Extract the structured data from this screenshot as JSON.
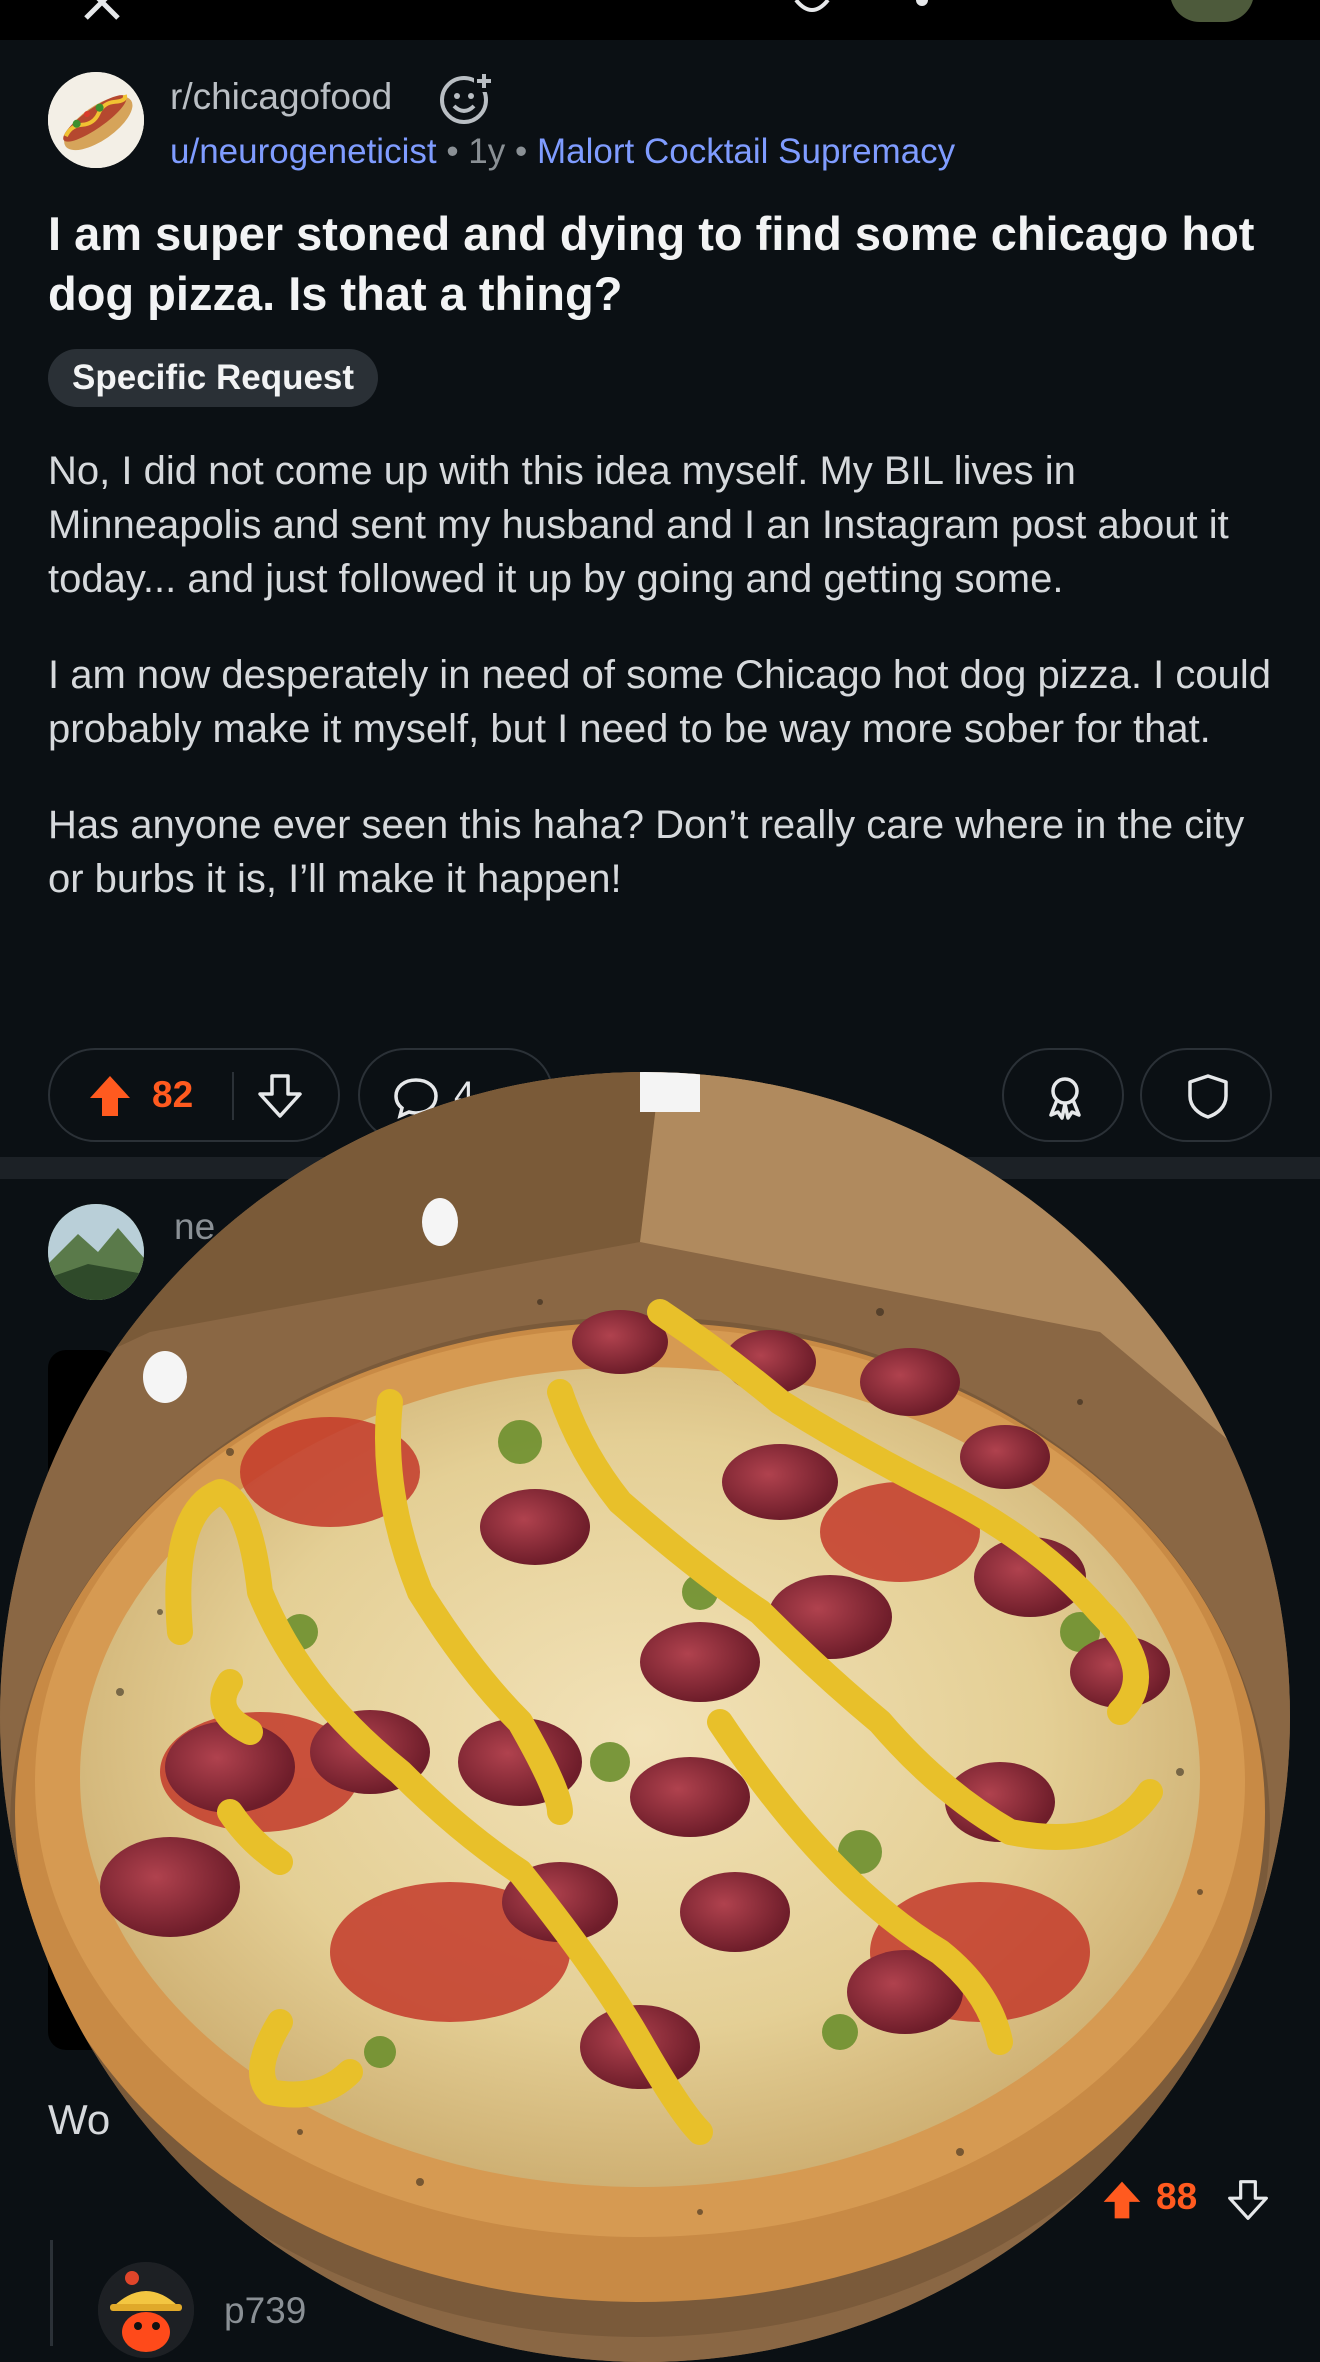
{
  "topbar": {
    "icons": [
      "close-icon",
      "shield-icon",
      "search-icon",
      "user-avatar"
    ]
  },
  "post": {
    "subreddit": "r/chicagofood",
    "author": "u/neurogeneticist",
    "age": "1y",
    "user_flair": "Malort Cocktail Supremacy",
    "title": "I am super stoned and dying to find some chicago hot dog pizza. Is that a thing?",
    "post_flair": "Specific Request",
    "body": [
      "No, I did not come up with this idea myself. My BIL lives in Minneapolis and sent my husband and I an Instagram post about it today... and just followed it up by going and getting some.",
      "I am now desperately in need of some Chicago hot dog pizza. I could probably make it myself, but I need to be way more sober for that.",
      "Has anyone ever seen this haha? Don’t really care where in the city or burbs it is, I’ll make it happen!"
    ],
    "score": "82",
    "comments_count_partial": "4",
    "icons": [
      "upvote-icon",
      "downvote-icon",
      "comment-icon",
      "award-icon",
      "mod-shield-icon"
    ]
  },
  "comment": {
    "author_partial": "ne",
    "text_partial": "Wo",
    "score": "88"
  },
  "reply": {
    "author_partial": "p739"
  },
  "colors": {
    "background": "#0b1014",
    "upvote": "#ff5a1f",
    "link": "#7f9cff"
  }
}
